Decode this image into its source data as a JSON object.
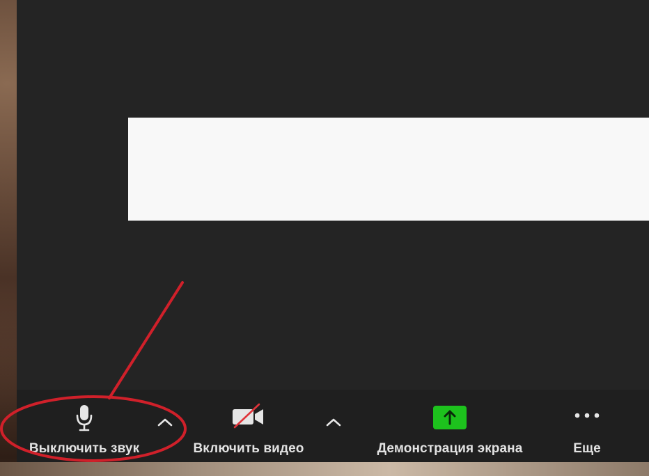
{
  "toolbar": {
    "mute": {
      "label": "Выключить звук",
      "icon": "microphone-icon"
    },
    "audio_options": {
      "icon": "chevron-up-icon"
    },
    "video": {
      "label": "Включить видео",
      "icon": "video-off-icon"
    },
    "video_options": {
      "icon": "chevron-up-icon"
    },
    "share": {
      "label": "Демонстрация экрана",
      "icon": "share-screen-arrow-icon"
    },
    "more": {
      "label": "Еще",
      "icon": "ellipsis-icon"
    }
  },
  "colors": {
    "window_bg": "#242424",
    "toolbar_bg": "#1f1f1f",
    "text": "#e2e2e2",
    "share_green": "#1dc21d",
    "annotation_red": "#d0202a",
    "video_slash_red": "#e0343a"
  }
}
